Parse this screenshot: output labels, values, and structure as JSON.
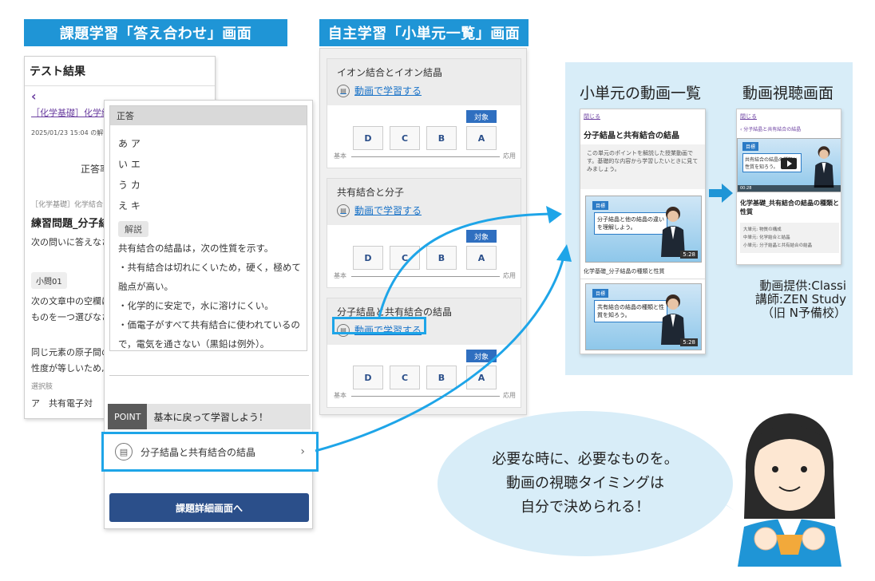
{
  "banners": {
    "left": "課題学習「答え合わせ」画面",
    "middle": "自主学習「小単元一覧」画面"
  },
  "left_back": {
    "title": "テスト結果",
    "back_chevron": "‹",
    "course_link": "［化学基礎］化学結",
    "date": "2025/01/23 15:04 の解答",
    "rate_label": "正答率",
    "subject_small": "［化学基礎］化学結合",
    "exercise_title": "練習問題_分子結晶",
    "instruction": "次の問いに答えなさ",
    "q_label": "小問01",
    "q_text1": "次の文章中の空欄に",
    "q_text2": "ものを一つ選びなさ",
    "q_text3": "同じ元素の原子間の",
    "q_text4": "性度が等しいため,",
    "choices_label": "選択肢",
    "choice_a": "ア　共有電子対"
  },
  "left_front": {
    "answer_header": "正答",
    "answers": [
      "あ ア",
      "い エ",
      "う カ",
      "え キ"
    ],
    "explanation_tag": "解説",
    "explanation": [
      "共有結合の結晶は，次の性質を示す。",
      "・共有結合は切れにくいため，硬く，極めて",
      "融点が高い。",
      "・化学的に安定で，水に溶けにくい。",
      "・価電子がすべて共有結合に使われているの",
      "で，電気を通さない（黒鉛は例外）。"
    ],
    "point_label": "POINT",
    "point_text": "基本に戻って学習しよう！",
    "unit_link": "分子結晶と共有結合の結晶",
    "unit_chevron": "›",
    "detail_button": "課題詳細画面へ"
  },
  "middle": {
    "sections": [
      {
        "title": "イオン結合とイオン結晶",
        "link": "動画で学習する"
      },
      {
        "title": "共有結合と分子",
        "link": "動画で学習する"
      },
      {
        "title": "分子結晶と共有結合の結晶",
        "link": "動画で学習する"
      }
    ],
    "levels": [
      "D",
      "C",
      "B",
      "A"
    ],
    "target_badge": "対象",
    "axis_left": "基本",
    "axis_right": "応用"
  },
  "right": {
    "heading_list": "小単元の動画一覧",
    "heading_player": "動画視聴画面",
    "list_phone": {
      "close": "閉じる",
      "title": "分子結晶と共有結合の結晶",
      "desc": "この単元のポイントを解説した授業動画です。基礎的な内容から学習したいときに見てみましょう。",
      "video1_badge": "目標",
      "video1_caption": "分子結晶と他の結晶の違いを理解しよう。",
      "video1_time": "5:28",
      "video1_title": "化学基礎_分子結晶の種類と性質",
      "video2_badge": "目標",
      "video2_caption": "共有結合の結晶の種類と性質を知ろう。",
      "video2_time": "5:28"
    },
    "player_phone": {
      "close": "閉じる",
      "back": "‹ 分子結晶と共有結合の結晶",
      "badge": "目標",
      "caption": "共有結合の結晶の種類と性質を知ろう。",
      "time": "00:28",
      "title": "化学基礎_共有結合の結晶の種類と性質",
      "meta": [
        "大単元:  物質の構成",
        "中単元:  化学結合と結晶",
        "小単元:  分子結晶と共有結合の結晶"
      ]
    },
    "credits": [
      "動画提供:Classi",
      "講師:ZEN Study",
      "（旧 N予備校）"
    ]
  },
  "bubble": {
    "lines": [
      "必要な時に、必要なものを。",
      "動画の視聴タイミングは",
      "自分で決められる！"
    ]
  },
  "colors": {
    "accent": "#1f95d6",
    "highlight": "#1ea5e8",
    "button": "#2b4f8a",
    "panel_bg": "#d8edf8"
  }
}
